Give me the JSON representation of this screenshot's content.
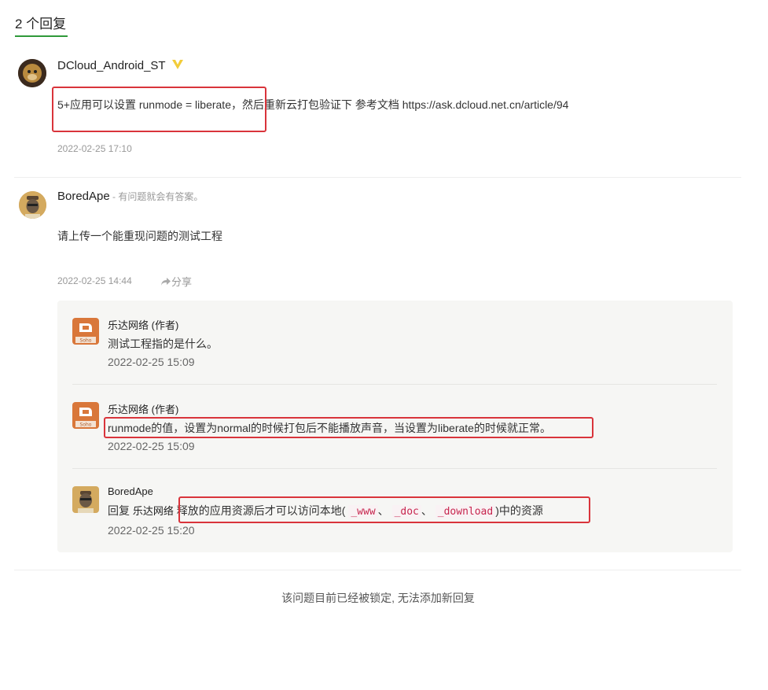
{
  "header": {
    "reply_count": "2 个回复"
  },
  "answers": [
    {
      "username": "DCloud_Android_ST",
      "content": "5+应用可以设置 runmode = liberate，然后重新云打包验证下 参考文档 https://ask.dcloud.net.cn/article/94",
      "time": "2022-02-25 17:10"
    },
    {
      "username": "BoredApe",
      "signature": " - 有问题就会有答案。",
      "content": "请上传一个能重现问题的测试工程",
      "time": "2022-02-25 14:44",
      "share_label": "分享",
      "comments": [
        {
          "username": "乐达网络 (作者)",
          "text": "测试工程指的是什么。",
          "time": "2022-02-25 15:09",
          "avatar_label": "Soho"
        },
        {
          "username": "乐达网络 (作者)",
          "text": "runmode的值，设置为normal的时候打包后不能播放声音，当设置为liberate的时候就正常。",
          "time": "2022-02-25 15:09",
          "avatar_label": "Soho"
        },
        {
          "username": "BoredApe",
          "reply_prefix": "回复 ",
          "reply_to": "乐达网络",
          "text_a": "释放的应用资源后才可以访问本地(",
          "code1": "_www",
          "sep1": "、",
          "code2": "_doc",
          "sep2": "、",
          "code3": "_download",
          "text_b": ")中的资源",
          "time": "2022-02-25 15:20"
        }
      ]
    }
  ],
  "footer": {
    "locked_text": "该问题目前已经被锁定, 无法添加新回复"
  },
  "colors": {
    "accent_green": "#2f9a3a",
    "highlight_red": "#d9343b",
    "vip_yellow": "#f2cc3a",
    "brand_orange": "#d9773a"
  },
  "icons": {
    "vip": "vip-v-icon",
    "share": "share-arrow-icon"
  }
}
